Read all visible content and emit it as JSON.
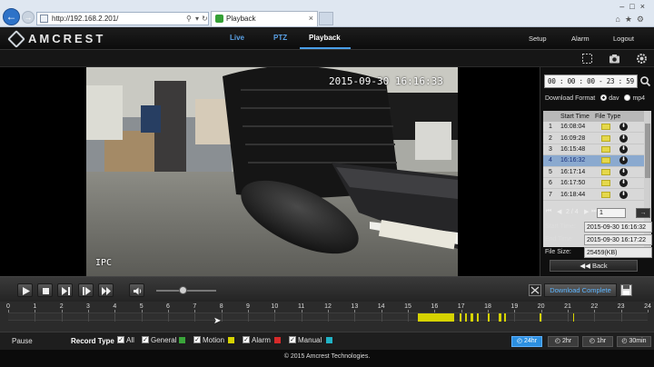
{
  "browser": {
    "url": "http://192.168.2.201/",
    "tab_title": "Playback"
  },
  "header": {
    "logo_text": "AMCREST",
    "nav": {
      "live": "Live",
      "ptz": "PTZ",
      "playback": "Playback"
    },
    "links": {
      "setup": "Setup",
      "alarm": "Alarm",
      "logout": "Logout"
    }
  },
  "video": {
    "timestamp": "2015-09-30 16:16:33",
    "channel_label": "IPC"
  },
  "panel": {
    "time_range": "00 : 00 : 00 - 23 : 59 : 59",
    "download_format_label": "Download Format",
    "format_options": [
      "dav",
      "mp4"
    ],
    "format_selected": "dav",
    "columns": {
      "start_time": "Start Time",
      "file_type": "File Type"
    },
    "files": [
      {
        "n": "1",
        "time": "16:08:04"
      },
      {
        "n": "2",
        "time": "16:09:28"
      },
      {
        "n": "3",
        "time": "16:15:48"
      },
      {
        "n": "4",
        "time": "16:16:32"
      },
      {
        "n": "5",
        "time": "16:17:14"
      },
      {
        "n": "6",
        "time": "16:17:50"
      },
      {
        "n": "7",
        "time": "16:18:44"
      }
    ],
    "selected_row": "4",
    "page_indicator": "2 / 4",
    "page_input": "1",
    "start_time_label": "Start Time:",
    "start_time_value": "2015-09-30 16:16:32",
    "end_time_label": "End Time:",
    "end_time_value": "2015-09-30 16:17:22",
    "file_size_label": "File Size:",
    "file_size_value": "25459(KB)",
    "back_label": "Back"
  },
  "controls": {
    "download_complete": "Download Complete",
    "volume_level": 0.45
  },
  "timeline": {
    "hours": [
      "0",
      "1",
      "2",
      "3",
      "4",
      "5",
      "6",
      "7",
      "8",
      "9",
      "10",
      "11",
      "12",
      "13",
      "14",
      "15",
      "16",
      "17",
      "18",
      "19",
      "20",
      "21",
      "22",
      "23",
      "24"
    ]
  },
  "bottom": {
    "status": "Pause",
    "record_type_label": "Record Type",
    "types": [
      {
        "label": "All",
        "color": ""
      },
      {
        "label": "General",
        "color": "#3aa53a"
      },
      {
        "label": "Motion",
        "color": "#d6d300"
      },
      {
        "label": "Alarm",
        "color": "#d62a2a"
      },
      {
        "label": "Manual",
        "color": "#21b3c6"
      }
    ],
    "zoom": [
      "24hr",
      "2hr",
      "1hr",
      "30min"
    ],
    "zoom_selected": "24hr"
  },
  "footer": {
    "copyright": "© 2015 Amcrest Technologies."
  },
  "colors": {
    "accent": "#2c8fe0",
    "nav_blue": "#5aa1e5",
    "motion_yellow": "#d6d300"
  }
}
